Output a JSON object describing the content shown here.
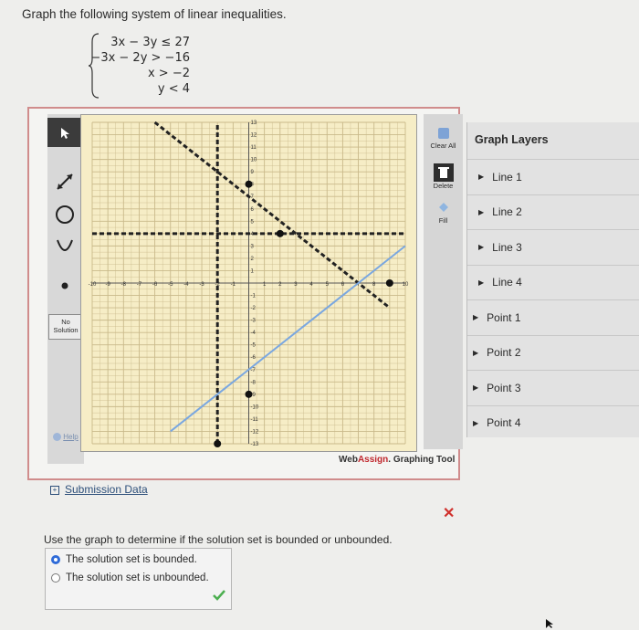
{
  "prompt": "Graph the following system of linear inequalities.",
  "inequalities": [
    "3x − 3y ≤ 27",
    "−3x − 2y > −16",
    "x > −2",
    "y < 4"
  ],
  "toolbar": {
    "tools": [
      "pointer-tool",
      "line-tool",
      "circle-tool",
      "parabola-tool",
      "point-tool"
    ],
    "no_solution": [
      "No",
      "Solution"
    ],
    "help": "Help"
  },
  "graph": {
    "x_ticks": [
      "-10",
      "-9",
      "-8",
      "-7",
      "-6",
      "-5",
      "-4",
      "-3",
      "-2",
      "-1",
      "1",
      "2",
      "3",
      "4",
      "5",
      "6",
      "7",
      "8",
      "9",
      "10"
    ],
    "y_ticks_pos": [
      "13",
      "12",
      "11",
      "10",
      "9",
      "8",
      "7",
      "6",
      "5",
      "4",
      "3",
      "2",
      "1"
    ],
    "y_ticks_neg": [
      "-1",
      "-2",
      "-3",
      "-4",
      "-5",
      "-6",
      "-7",
      "-8",
      "-9",
      "-10",
      "-11",
      "-12",
      "-13"
    ],
    "x_range": [
      -10,
      10
    ],
    "y_range": [
      -13,
      13
    ],
    "boundary_lines": [
      {
        "label": "line through (-6,13) and (9,-2)",
        "p1": [
          -6,
          13
        ],
        "p2": [
          9,
          -2
        ],
        "style": "dashed",
        "color": "#222222"
      },
      {
        "label": "line through (-2,0) and (0,8)",
        "p1": [
          -2,
          -13
        ],
        "p2": [
          -2,
          13
        ],
        "style": "dashed",
        "color": "#222222"
      },
      {
        "label": "horizontal",
        "p1": [
          -10,
          4
        ],
        "p2": [
          10,
          4
        ],
        "style": "dashed",
        "color": "#222222"
      },
      {
        "label": "solid",
        "p1": [
          -5,
          -12
        ],
        "p2": [
          10,
          3
        ],
        "style": "solid",
        "color": "#7aa7e0"
      }
    ],
    "points": [
      [
        0,
        8
      ],
      [
        2,
        4
      ],
      [
        9,
        0
      ],
      [
        -2,
        -13
      ],
      [
        0,
        -9
      ]
    ],
    "grid_color": "#c9b98a",
    "background": "#f6edc6"
  },
  "right_buttons": {
    "clear_all": "Clear All",
    "delete": "Delete",
    "fill": "Fill"
  },
  "brand": {
    "web": "Web",
    "assign": "Assign",
    "rest": ". Graphing Tool"
  },
  "layers": {
    "title": "Graph Layers",
    "items": [
      "Line 1",
      "Line 2",
      "Line 3",
      "Line 4",
      "Point 1",
      "Point 2",
      "Point 3",
      "Point 4"
    ]
  },
  "submission": "Submission Data",
  "question": "Use the graph to determine if the solution set is bounded or unbounded.",
  "answers": [
    {
      "label": "The solution set is bounded.",
      "selected": true
    },
    {
      "label": "The solution set is unbounded.",
      "selected": false
    }
  ],
  "colors": {
    "accent": "#2f6bd8",
    "error": "#d0312d",
    "correct": "#4caf50"
  }
}
